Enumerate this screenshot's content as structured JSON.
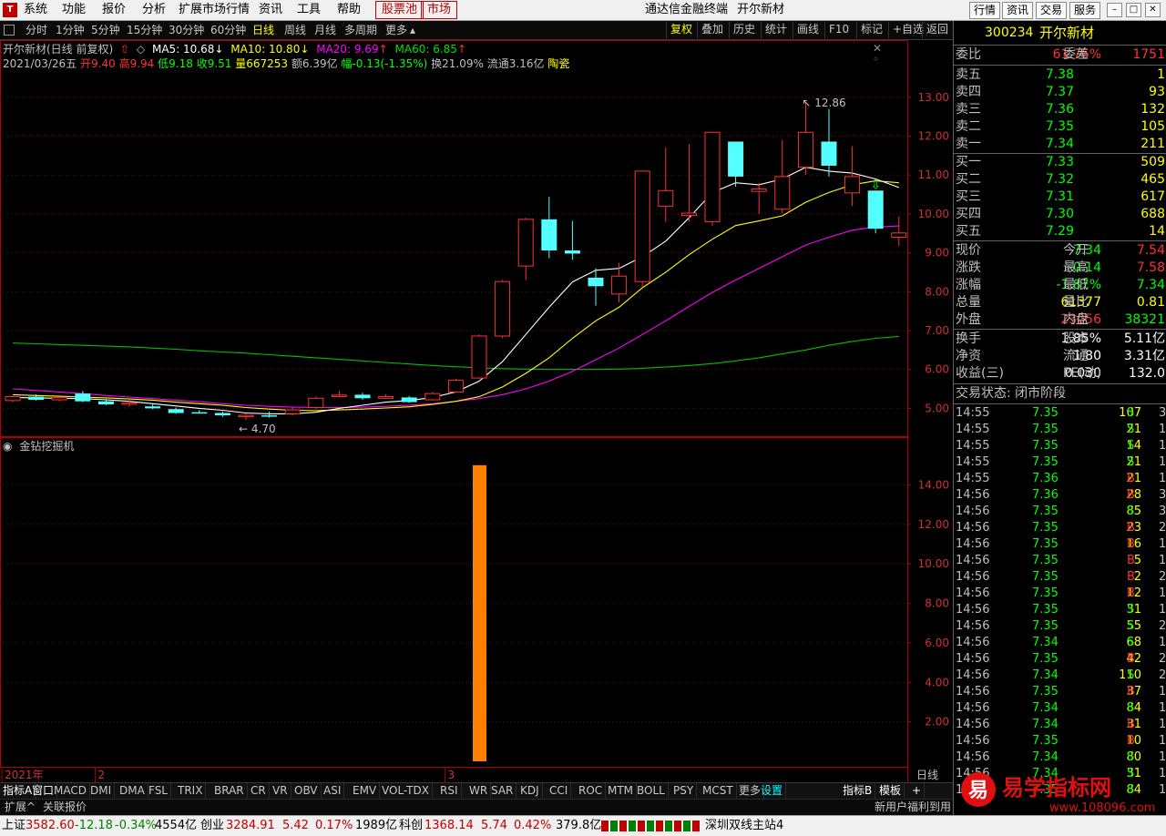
{
  "menubar": {
    "items": [
      "系统",
      "功能",
      "报价",
      "分析",
      "扩展市场行情",
      "资讯",
      "工具",
      "帮助"
    ],
    "boxed": [
      "股票池",
      "市场"
    ],
    "app_title": "通达信金融终端",
    "stock_title": "开尔新材",
    "right_buttons": [
      "行情",
      "资讯",
      "交易",
      "服务"
    ]
  },
  "toolbar": {
    "periods": [
      "分时",
      "1分钟",
      "5分钟",
      "15分钟",
      "30分钟",
      "60分钟",
      "日线",
      "周线",
      "月线",
      "多周期",
      "更多"
    ],
    "active_period": "日线",
    "buttons": [
      "复权",
      "叠加",
      "历史",
      "统计",
      "画线",
      "F10",
      "标记",
      "+自选",
      "返回"
    ]
  },
  "ma_line": {
    "name": "开尔新材(日线 前复权)",
    "ma5": "MA5: 10.68",
    "ma10": "MA10: 10.80",
    "ma20": "MA20: 9.69",
    "ma60": "MA60: 6.85"
  },
  "ohlc_line": {
    "date": "2021/03/26五",
    "open": "开9.40",
    "high": "高9.94",
    "low": "低9.18",
    "close": "收9.51",
    "vol": "量667253",
    "amount": "额6.39亿",
    "change": "幅-0.13(-1.35%)",
    "turnover": "换21.09%",
    "float": "流通3.16亿",
    "sector": "陶瓷"
  },
  "chart_data": {
    "type": "candlestick",
    "yaxis_main": [
      "13.00",
      "12.00",
      "11.00",
      "10.00",
      "9.00",
      "8.00",
      "7.00",
      "6.00",
      "5.00"
    ],
    "ylim_main": [
      4.4,
      13.3
    ],
    "max_label": "12.86",
    "min_label": "4.70",
    "candles": [
      {
        "o": 5.2,
        "h": 5.32,
        "l": 5.16,
        "c": 5.3
      },
      {
        "o": 5.3,
        "h": 5.36,
        "l": 5.2,
        "c": 5.22
      },
      {
        "o": 5.22,
        "h": 5.3,
        "l": 5.18,
        "c": 5.28
      },
      {
        "o": 5.38,
        "h": 5.45,
        "l": 5.16,
        "c": 5.18
      },
      {
        "o": 5.18,
        "h": 5.24,
        "l": 5.08,
        "c": 5.1
      },
      {
        "o": 5.12,
        "h": 5.22,
        "l": 5.04,
        "c": 5.14
      },
      {
        "o": 5.05,
        "h": 5.1,
        "l": 4.98,
        "c": 5.0
      },
      {
        "o": 4.98,
        "h": 5.02,
        "l": 4.86,
        "c": 4.88
      },
      {
        "o": 4.9,
        "h": 4.96,
        "l": 4.86,
        "c": 4.88
      },
      {
        "o": 4.88,
        "h": 4.92,
        "l": 4.78,
        "c": 4.82
      },
      {
        "o": 4.8,
        "h": 4.86,
        "l": 4.7,
        "c": 4.82
      },
      {
        "o": 4.82,
        "h": 4.92,
        "l": 4.76,
        "c": 4.8
      },
      {
        "o": 4.86,
        "h": 5.02,
        "l": 4.82,
        "c": 4.96
      },
      {
        "o": 5.02,
        "h": 5.3,
        "l": 4.98,
        "c": 5.26
      },
      {
        "o": 5.32,
        "h": 5.45,
        "l": 5.28,
        "c": 5.34
      },
      {
        "o": 5.35,
        "h": 5.4,
        "l": 5.22,
        "c": 5.26
      },
      {
        "o": 5.26,
        "h": 5.36,
        "l": 5.24,
        "c": 5.3
      },
      {
        "o": 5.28,
        "h": 5.32,
        "l": 5.14,
        "c": 5.16
      },
      {
        "o": 5.22,
        "h": 5.42,
        "l": 5.2,
        "c": 5.38
      },
      {
        "o": 5.42,
        "h": 5.76,
        "l": 5.4,
        "c": 5.72
      },
      {
        "o": 5.78,
        "h": 6.9,
        "l": 5.76,
        "c": 6.86
      },
      {
        "o": 6.86,
        "h": 8.3,
        "l": 6.8,
        "c": 8.26
      },
      {
        "o": 8.66,
        "h": 9.9,
        "l": 8.3,
        "c": 9.86
      },
      {
        "o": 9.86,
        "h": 10.44,
        "l": 8.86,
        "c": 9.06
      },
      {
        "o": 9.06,
        "h": 9.82,
        "l": 8.82,
        "c": 8.98
      },
      {
        "o": 8.36,
        "h": 8.6,
        "l": 7.64,
        "c": 8.14
      },
      {
        "o": 7.94,
        "h": 8.74,
        "l": 7.72,
        "c": 8.4
      },
      {
        "o": 8.26,
        "h": 11.1,
        "l": 8.1,
        "c": 11.1
      },
      {
        "o": 10.2,
        "h": 11.7,
        "l": 9.8,
        "c": 10.6
      },
      {
        "o": 9.96,
        "h": 11.8,
        "l": 9.8,
        "c": 10.02
      },
      {
        "o": 9.8,
        "h": 12.1,
        "l": 9.7,
        "c": 12.1
      },
      {
        "o": 11.86,
        "h": 11.86,
        "l": 10.7,
        "c": 10.96
      },
      {
        "o": 10.58,
        "h": 10.8,
        "l": 10.0,
        "c": 10.64
      },
      {
        "o": 10.12,
        "h": 11.9,
        "l": 10.02,
        "c": 10.96
      },
      {
        "o": 11.2,
        "h": 12.86,
        "l": 11.0,
        "c": 12.1
      },
      {
        "o": 11.86,
        "h": 12.7,
        "l": 10.96,
        "c": 11.24
      },
      {
        "o": 10.54,
        "h": 11.74,
        "l": 10.2,
        "c": 10.96
      },
      {
        "o": 10.6,
        "h": 10.6,
        "l": 9.5,
        "c": 9.62
      },
      {
        "o": 9.4,
        "h": 9.94,
        "l": 9.18,
        "c": 9.51
      }
    ],
    "ma5": [
      5.28,
      5.27,
      5.26,
      5.25,
      5.22,
      5.18,
      5.12,
      5.06,
      5.0,
      4.95,
      4.88,
      4.86,
      4.86,
      4.9,
      5.0,
      5.08,
      5.16,
      5.2,
      5.28,
      5.42,
      5.7,
      6.2,
      6.9,
      7.6,
      8.25,
      8.55,
      8.6,
      8.9,
      9.3,
      9.9,
      10.55,
      10.8,
      10.75,
      10.9,
      11.2,
      11.1,
      11.05,
      10.9,
      10.68
    ],
    "ma10": [
      5.35,
      5.33,
      5.31,
      5.29,
      5.27,
      5.24,
      5.21,
      5.16,
      5.12,
      5.08,
      5.02,
      4.98,
      4.95,
      4.94,
      4.96,
      4.98,
      5.01,
      5.04,
      5.1,
      5.18,
      5.3,
      5.55,
      5.9,
      6.3,
      6.8,
      7.25,
      7.6,
      8.1,
      8.5,
      8.95,
      9.35,
      9.7,
      9.82,
      9.95,
      10.3,
      10.55,
      10.75,
      10.85,
      10.8
    ],
    "ma20": [
      5.5,
      5.46,
      5.42,
      5.38,
      5.33,
      5.29,
      5.25,
      5.21,
      5.17,
      5.12,
      5.08,
      5.05,
      5.03,
      5.02,
      5.02,
      5.03,
      5.05,
      5.08,
      5.12,
      5.18,
      5.25,
      5.35,
      5.5,
      5.7,
      5.95,
      6.25,
      6.55,
      6.9,
      7.25,
      7.62,
      7.98,
      8.3,
      8.6,
      8.9,
      9.2,
      9.4,
      9.58,
      9.66,
      9.69
    ],
    "ma60": [
      6.68,
      6.66,
      6.64,
      6.62,
      6.6,
      6.58,
      6.55,
      6.52,
      6.48,
      6.45,
      6.42,
      6.38,
      6.34,
      6.3,
      6.26,
      6.22,
      6.18,
      6.14,
      6.1,
      6.07,
      6.04,
      6.02,
      6.01,
      6.0,
      6.0,
      6.0,
      6.01,
      6.03,
      6.06,
      6.1,
      6.15,
      6.22,
      6.3,
      6.4,
      6.5,
      6.62,
      6.72,
      6.8,
      6.85
    ],
    "signal_arrow_index": 37,
    "indicator_name": "金钻挖掘机",
    "yaxis_ind": [
      "14.00",
      "12.00",
      "10.00",
      "8.00",
      "6.00",
      "4.00",
      "2.00"
    ],
    "ylim_ind": [
      0,
      15.5
    ],
    "ind_bar": {
      "index": 20,
      "value": 15.0
    },
    "x_labels": [
      {
        "label": "2021年",
        "index": 0
      },
      {
        "label": "2",
        "index": 4
      },
      {
        "label": "3",
        "index": 19
      }
    ],
    "period_label": "日线"
  },
  "indicator_tabs": [
    "指标A",
    "窗口",
    "MACD",
    "DMI",
    "DMA",
    "FSL",
    "TRIX",
    "BRAR",
    "CR",
    "VR",
    "OBV",
    "ASI",
    "EMV",
    "VOL-TDX",
    "RSI",
    "WR",
    "SAR",
    "KDJ",
    "CCI",
    "ROC",
    "MTM",
    "BOLL",
    "PSY",
    "MCST",
    "更多",
    "设置"
  ],
  "indicator_tabs_right": [
    "指标B",
    "模板",
    "+"
  ],
  "ext_tabs": [
    "扩展^",
    "关联报价"
  ],
  "news_text": "新用户福利到用",
  "panel": {
    "code": "300234",
    "name": "开尔新材",
    "ratio": {
      "label": "委比",
      "pct": "61.76%",
      "label2": "委差",
      "diff": "1751"
    },
    "asks": [
      {
        "label": "卖五",
        "price": "7.38",
        "vol": "1"
      },
      {
        "label": "卖四",
        "price": "7.37",
        "vol": "93"
      },
      {
        "label": "卖三",
        "price": "7.36",
        "vol": "132"
      },
      {
        "label": "卖二",
        "price": "7.35",
        "vol": "105"
      },
      {
        "label": "卖一",
        "price": "7.34",
        "vol": "211"
      }
    ],
    "bids": [
      {
        "label": "买一",
        "price": "7.33",
        "vol": "509"
      },
      {
        "label": "买二",
        "price": "7.32",
        "vol": "465"
      },
      {
        "label": "买三",
        "price": "7.31",
        "vol": "617"
      },
      {
        "label": "买四",
        "price": "7.30",
        "vol": "688"
      },
      {
        "label": "买五",
        "price": "7.29",
        "vol": "14"
      }
    ],
    "quote": [
      {
        "l1": "现价",
        "v1": "7.34",
        "c1": "grn",
        "l2": "今开",
        "v2": "7.54",
        "c2": "red"
      },
      {
        "l1": "涨跌",
        "v1": "-0.14",
        "c1": "grn",
        "l2": "最高",
        "v2": "7.58",
        "c2": "red"
      },
      {
        "l1": "涨幅",
        "v1": "-1.87%",
        "c1": "grn",
        "l2": "最低",
        "v2": "7.34",
        "c2": "grn"
      },
      {
        "l1": "总量",
        "v1": "61377",
        "c1": "yel",
        "l2": "量比",
        "v2": "0.81",
        "c2": "yel"
      },
      {
        "l1": "外盘",
        "v1": "23056",
        "c1": "red",
        "l2": "内盘",
        "v2": "38321",
        "c2": "grn"
      }
    ],
    "fund": [
      {
        "l1": "换手",
        "v1": "1.85%",
        "l2": "股本",
        "v2": "5.11亿"
      },
      {
        "l1": "净资",
        "v1": "1.80",
        "l2": "流通",
        "v2": "3.31亿"
      },
      {
        "l1": "收益(三)",
        "v1": "0.030",
        "l2": "PE(动)",
        "v2": "132.0"
      }
    ],
    "trade_status": "交易状态: 闭市阶段",
    "ticks": [
      {
        "t": "14:55",
        "p": "7.35",
        "q": "107",
        "d": "S",
        "n": "3"
      },
      {
        "t": "14:55",
        "p": "7.35",
        "q": "21",
        "d": "S",
        "n": "1"
      },
      {
        "t": "14:55",
        "p": "7.35",
        "q": "14",
        "d": "S",
        "n": "1"
      },
      {
        "t": "14:55",
        "p": "7.35",
        "q": "21",
        "d": "S",
        "n": "1"
      },
      {
        "t": "14:55",
        "p": "7.36",
        "q": "21",
        "d": "B",
        "n": "1"
      },
      {
        "t": "14:56",
        "p": "7.36",
        "q": "28",
        "d": "B",
        "n": "3"
      },
      {
        "t": "14:56",
        "p": "7.35",
        "q": "85",
        "d": "S",
        "n": "3"
      },
      {
        "t": "14:56",
        "p": "7.35",
        "q": "23",
        "d": "B",
        "n": "2"
      },
      {
        "t": "14:56",
        "p": "7.35",
        "q": "16",
        "d": "B",
        "n": "1"
      },
      {
        "t": "14:56",
        "p": "7.35",
        "q": "5",
        "d": "B",
        "n": "1"
      },
      {
        "t": "14:56",
        "p": "7.35",
        "q": "2",
        "d": "B",
        "n": "2"
      },
      {
        "t": "14:56",
        "p": "7.35",
        "q": "12",
        "d": "B",
        "n": "1"
      },
      {
        "t": "14:56",
        "p": "7.35",
        "q": "31",
        "d": "S",
        "n": "1"
      },
      {
        "t": "14:56",
        "p": "7.35",
        "q": "55",
        "d": "S",
        "n": "2"
      },
      {
        "t": "14:56",
        "p": "7.34",
        "q": "68",
        "d": "S",
        "n": "10"
      },
      {
        "t": "14:56",
        "p": "7.35",
        "q": "42",
        "d": "B",
        "n": "2"
      },
      {
        "t": "14:56",
        "p": "7.34",
        "q": "110",
        "d": "S",
        "n": "2"
      },
      {
        "t": "14:56",
        "p": "7.35",
        "q": "37",
        "d": "B",
        "n": "1"
      },
      {
        "t": "14:56",
        "p": "7.34",
        "q": "84",
        "d": "S",
        "n": "1"
      },
      {
        "t": "14:56",
        "p": "7.34",
        "q": "31",
        "d": "B",
        "n": "1"
      },
      {
        "t": "14:56",
        "p": "7.35",
        "q": "10",
        "d": "B",
        "n": "1"
      },
      {
        "t": "14:56",
        "p": "7.34",
        "q": "80",
        "d": "S",
        "n": "16"
      },
      {
        "t": "14:56",
        "p": "7.34",
        "q": "31",
        "d": "S",
        "n": "1"
      },
      {
        "t": "14:56",
        "p": "7.35",
        "q": "84",
        "d": "S",
        "n": "1"
      }
    ]
  },
  "statusbar": {
    "sh_label": "上证",
    "sh_val": "3582.60",
    "sh_chg": "-12.18",
    "sh_pct": "-0.34%",
    "sh_amt": "4554亿",
    "cy_label": "创业",
    "cy_val": "3284.91",
    "cy_chg": "5.42",
    "cy_pct": "0.17%",
    "cy_amt": "1989亿",
    "kc_label": "科创",
    "kc_val": "1368.14",
    "kc_chg": "5.74",
    "kc_pct": "0.42%",
    "kc_amt": "379.8亿",
    "server": "深圳双线主站4"
  },
  "watermark": {
    "brand": "易学指标网",
    "url": "www.108096.com"
  },
  "colors": {
    "up": "#ff3232",
    "down": "#54ffff",
    "ma5": "#ffffff",
    "ma10": "#ffff00",
    "ma20": "#ff00ff",
    "ma60": "#00c000",
    "indicator": "#ff7f00",
    "frame": "#b00000"
  }
}
